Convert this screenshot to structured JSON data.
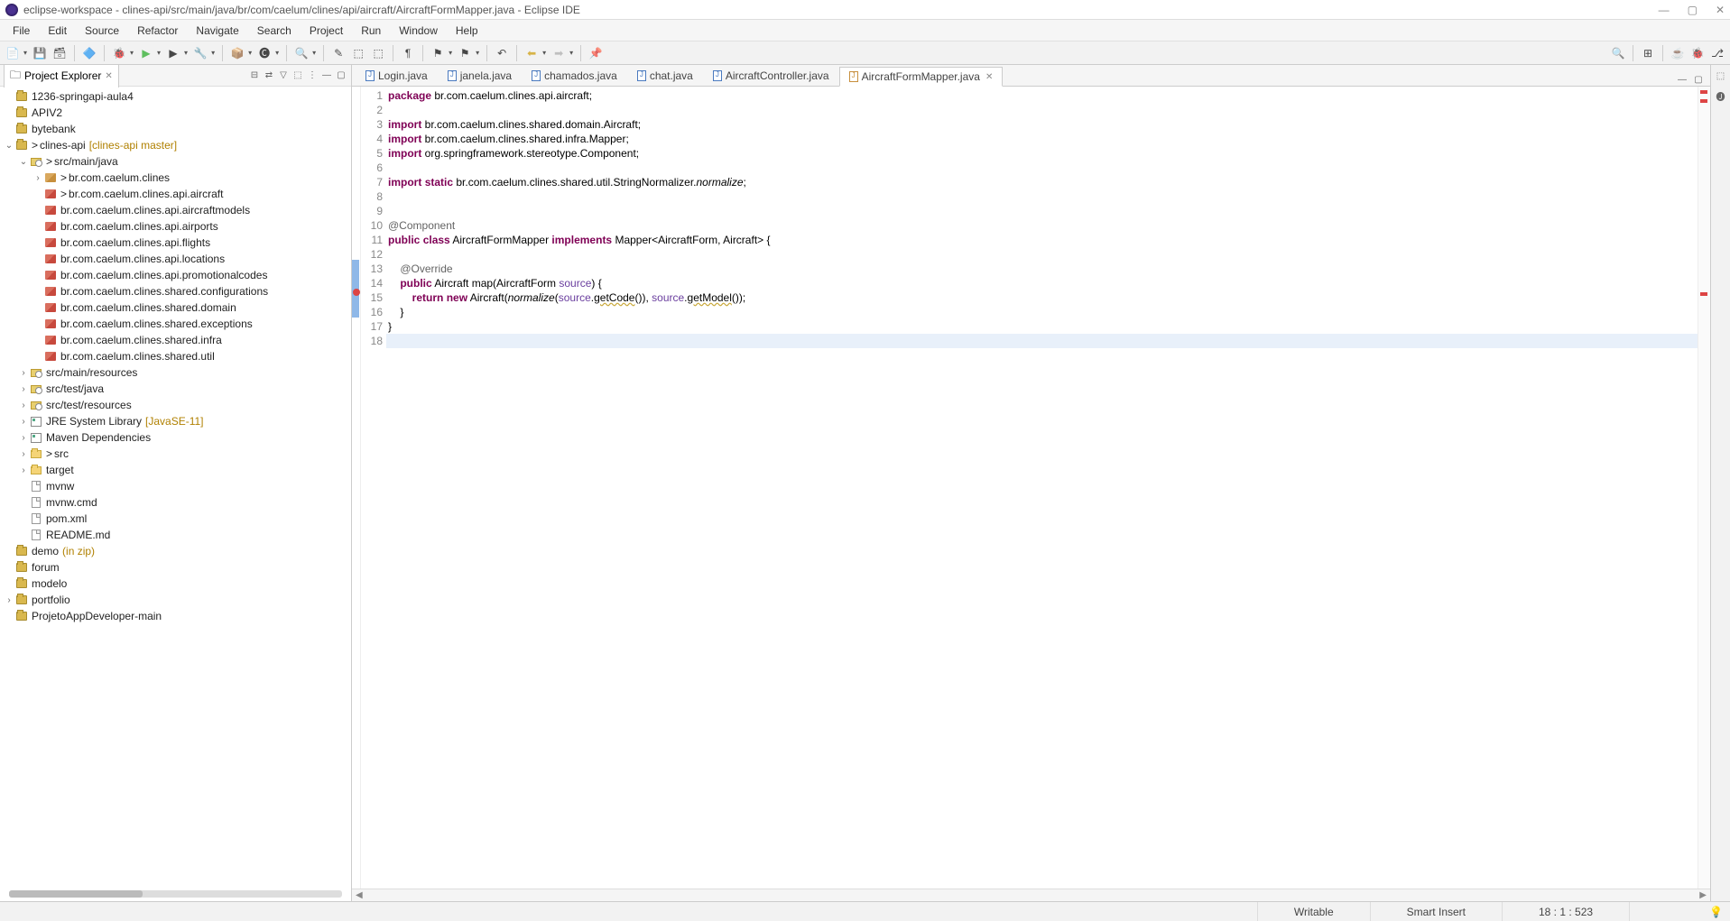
{
  "window": {
    "title": "eclipse-workspace - clines-api/src/main/java/br/com/caelum/clines/api/aircraft/AircraftFormMapper.java - Eclipse IDE"
  },
  "menu": [
    "File",
    "Edit",
    "Source",
    "Refactor",
    "Navigate",
    "Search",
    "Project",
    "Run",
    "Window",
    "Help"
  ],
  "explorer": {
    "title": "Project Explorer",
    "items": [
      {
        "level": 0,
        "expand": "",
        "icon": "project",
        "label": "1236-springapi-aula4"
      },
      {
        "level": 0,
        "expand": "",
        "icon": "project",
        "label": "APIV2"
      },
      {
        "level": 0,
        "expand": "",
        "icon": "project",
        "label": "bytebank"
      },
      {
        "level": 0,
        "expand": "v",
        "icon": "project-red",
        "vcs": ">",
        "label": "clines-api",
        "decorator": "[clines-api master]"
      },
      {
        "level": 1,
        "expand": "v",
        "icon": "src-folder",
        "vcs": ">",
        "label": "src/main/java"
      },
      {
        "level": 2,
        "expand": ">",
        "icon": "package",
        "vcs": ">",
        "label": "br.com.caelum.clines"
      },
      {
        "level": 2,
        "expand": "",
        "icon": "package-red",
        "vcs": ">",
        "label": "br.com.caelum.clines.api.aircraft"
      },
      {
        "level": 2,
        "expand": "",
        "icon": "package-red",
        "label": "br.com.caelum.clines.api.aircraftmodels"
      },
      {
        "level": 2,
        "expand": "",
        "icon": "package-red",
        "label": "br.com.caelum.clines.api.airports"
      },
      {
        "level": 2,
        "expand": "",
        "icon": "package-red",
        "label": "br.com.caelum.clines.api.flights"
      },
      {
        "level": 2,
        "expand": "",
        "icon": "package-red",
        "label": "br.com.caelum.clines.api.locations"
      },
      {
        "level": 2,
        "expand": "",
        "icon": "package-red",
        "label": "br.com.caelum.clines.api.promotionalcodes"
      },
      {
        "level": 2,
        "expand": "",
        "icon": "package-red",
        "label": "br.com.caelum.clines.shared.configurations"
      },
      {
        "level": 2,
        "expand": "",
        "icon": "package-red",
        "label": "br.com.caelum.clines.shared.domain"
      },
      {
        "level": 2,
        "expand": "",
        "icon": "package-red",
        "label": "br.com.caelum.clines.shared.exceptions"
      },
      {
        "level": 2,
        "expand": "",
        "icon": "package-red",
        "label": "br.com.caelum.clines.shared.infra"
      },
      {
        "level": 2,
        "expand": "",
        "icon": "package-red",
        "label": "br.com.caelum.clines.shared.util"
      },
      {
        "level": 1,
        "expand": ">",
        "icon": "src-folder",
        "label": "src/main/resources"
      },
      {
        "level": 1,
        "expand": ">",
        "icon": "src-folder",
        "label": "src/test/java"
      },
      {
        "level": 1,
        "expand": ">",
        "icon": "src-folder",
        "label": "src/test/resources"
      },
      {
        "level": 1,
        "expand": ">",
        "icon": "lib",
        "label": "JRE System Library",
        "decorator": "[JavaSE-11]"
      },
      {
        "level": 1,
        "expand": ">",
        "icon": "lib",
        "label": "Maven Dependencies"
      },
      {
        "level": 1,
        "expand": ">",
        "icon": "folder-red",
        "vcs": ">",
        "label": "src"
      },
      {
        "level": 1,
        "expand": ">",
        "icon": "folder",
        "label": "target"
      },
      {
        "level": 1,
        "expand": "",
        "icon": "file",
        "label": "mvnw"
      },
      {
        "level": 1,
        "expand": "",
        "icon": "file",
        "label": "mvnw.cmd"
      },
      {
        "level": 1,
        "expand": "",
        "icon": "file",
        "label": "pom.xml"
      },
      {
        "level": 1,
        "expand": "",
        "icon": "file",
        "label": "README.md"
      },
      {
        "level": 0,
        "expand": "",
        "icon": "project",
        "label": "demo",
        "decorator": "(in zip)"
      },
      {
        "level": 0,
        "expand": "",
        "icon": "project",
        "label": "forum"
      },
      {
        "level": 0,
        "expand": "",
        "icon": "project",
        "label": "modelo"
      },
      {
        "level": 0,
        "expand": ">",
        "icon": "project",
        "label": "portfolio"
      },
      {
        "level": 0,
        "expand": "",
        "icon": "project",
        "label": "ProjetoAppDeveloper-main"
      }
    ]
  },
  "editor": {
    "tabs": [
      {
        "label": "Login.java",
        "icon": "java",
        "active": false
      },
      {
        "label": "janela.java",
        "icon": "java",
        "active": false
      },
      {
        "label": "chamados.java",
        "icon": "java",
        "active": false
      },
      {
        "label": "chat.java",
        "icon": "java",
        "active": false
      },
      {
        "label": "AircraftController.java",
        "icon": "java",
        "active": false
      },
      {
        "label": "AircraftFormMapper.java",
        "icon": "java-warn",
        "active": true
      }
    ],
    "lines": 18
  },
  "status": {
    "writable": "Writable",
    "insert": "Smart Insert",
    "position": "18 : 1 : 523"
  }
}
